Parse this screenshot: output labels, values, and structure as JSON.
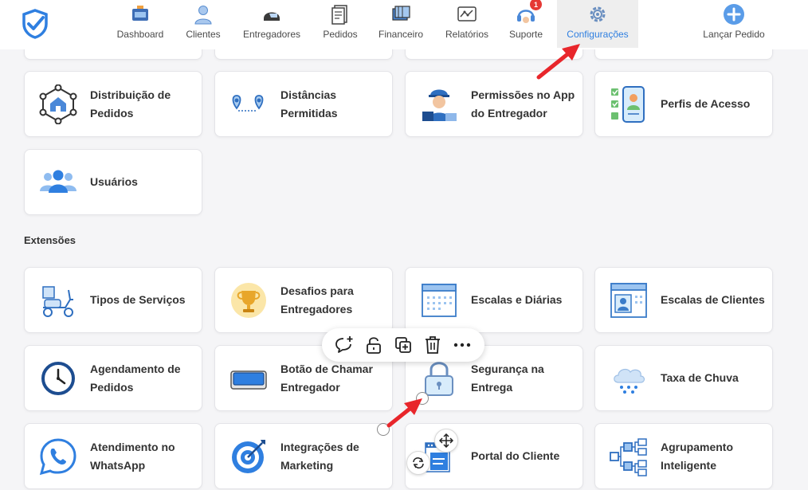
{
  "nav": {
    "items": [
      {
        "label": "Dashboard"
      },
      {
        "label": "Clientes"
      },
      {
        "label": "Entregadores"
      },
      {
        "label": "Pedidos"
      },
      {
        "label": "Financeiro"
      },
      {
        "label": "Relatórios"
      },
      {
        "label": "Suporte",
        "badge": "1"
      },
      {
        "label": "Configurações"
      },
      {
        "label": "Lançar Pedido"
      }
    ],
    "active": "Configurações"
  },
  "cards": {
    "distribuicao": "Distribuição de Pedidos",
    "distancias": "Distâncias Permitidas",
    "permissoes": "Permissões no App do Entregador",
    "perfis": "Perfis de Acesso",
    "usuarios": "Usuários",
    "tipos": "Tipos de Serviços",
    "desafios": "Desafios para Entregadores",
    "escalas_diarias": "Escalas e Diárias",
    "escalas_clientes": "Escalas de Clientes",
    "agendamento": "Agendamento de Pedidos",
    "botao": "Botão de Chamar Entregador",
    "seguranca": "Segurança na Entrega",
    "chuva": "Taxa de Chuva",
    "whatsapp": "Atendimento no WhatsApp",
    "integracoes": "Integrações de Marketing",
    "portal": "Portal do Cliente",
    "agrupamento": "Agrupamento Inteligente"
  },
  "sections": {
    "extensoes": "Extensões"
  },
  "colors": {
    "accent": "#2f7fe0",
    "badge": "#e53935",
    "arrow": "#e8262b"
  },
  "toolbar_icons": [
    "add-comment-icon",
    "lock-icon",
    "duplicate-icon",
    "trash-icon",
    "more-icon"
  ]
}
